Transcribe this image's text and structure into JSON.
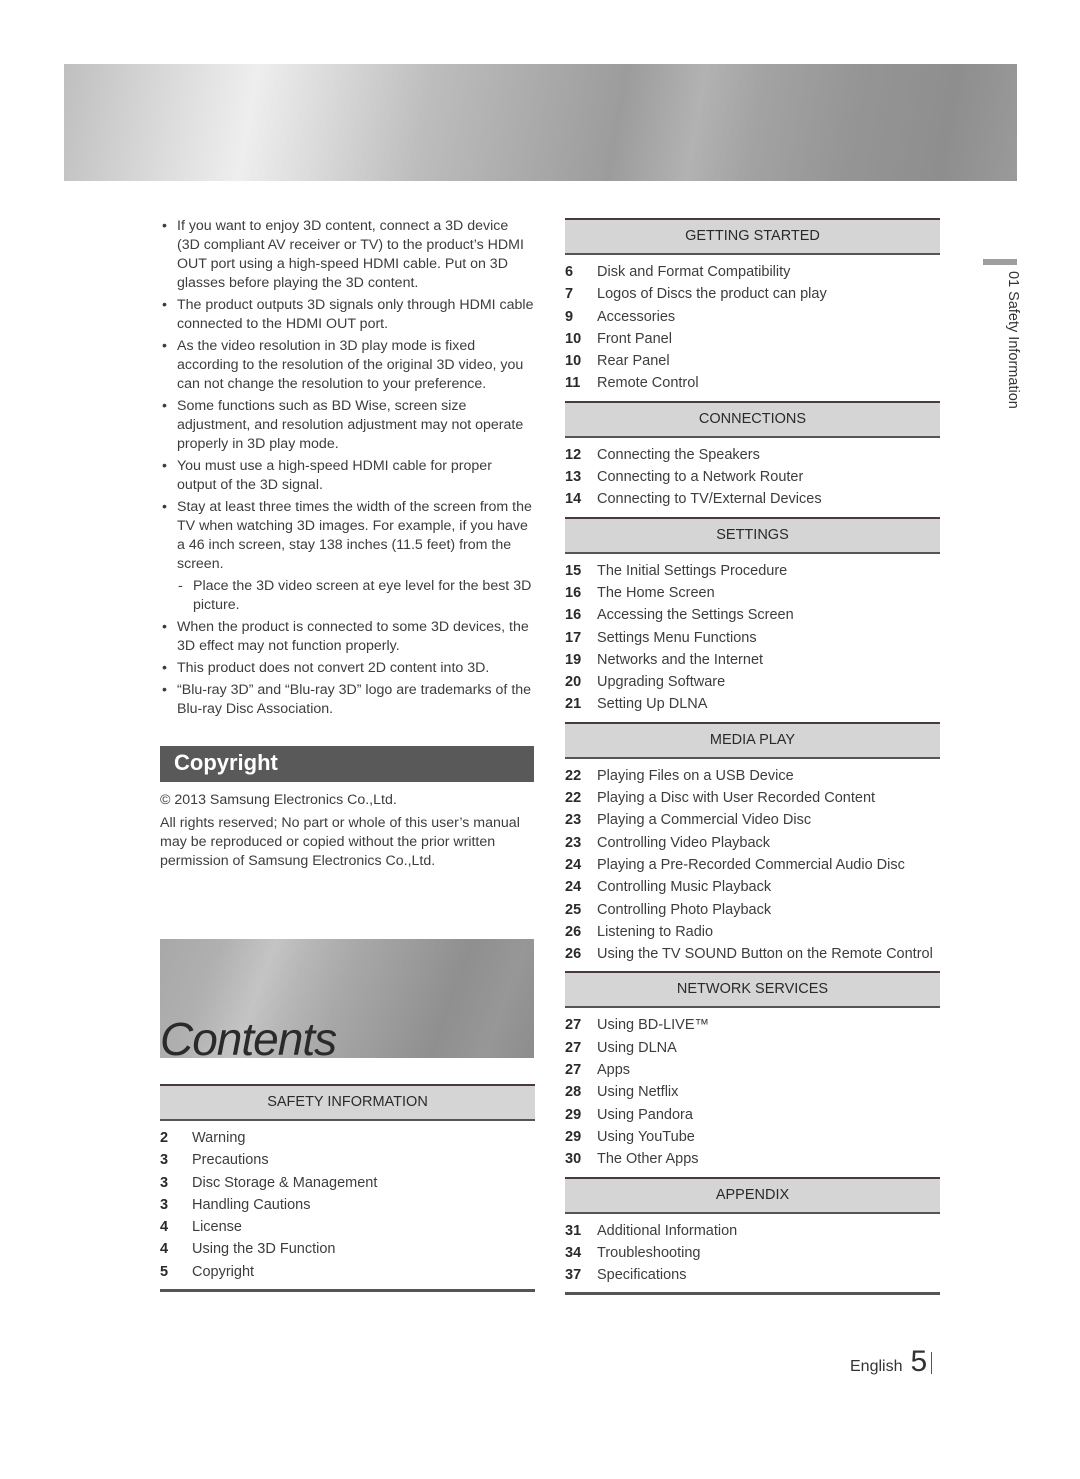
{
  "bullets": [
    {
      "type": "bullet",
      "marker": "•",
      "text": "If you want to enjoy 3D content, connect a 3D device (3D compliant AV receiver or TV) to the product’s HDMI OUT port using a high-speed HDMI cable. Put on 3D glasses before playing the 3D content."
    },
    {
      "type": "bullet",
      "marker": "•",
      "text": "The product outputs 3D signals only through HDMI cable connected to the HDMI OUT port."
    },
    {
      "type": "bullet",
      "marker": "•",
      "text": "As the video resolution in 3D play mode is fixed according to the resolution of the original 3D video, you can not change the resolution to your preference."
    },
    {
      "type": "bullet",
      "marker": "•",
      "text": "Some functions such as BD Wise, screen size adjustment, and resolution adjustment may not operate properly in 3D play mode."
    },
    {
      "type": "bullet",
      "marker": "•",
      "text": "You must use a high-speed HDMI cable for proper output of the 3D signal."
    },
    {
      "type": "bullet",
      "marker": "•",
      "text": "Stay at least three times the width of the screen from the TV when watching 3D images. For example, if you have a 46 inch screen, stay 138 inches (11.5 feet) from the screen."
    },
    {
      "type": "sub",
      "marker": "-",
      "text": "Place the 3D video screen at eye level for the best 3D picture."
    },
    {
      "type": "bullet",
      "marker": "•",
      "text": "When the product is connected to some 3D devices, the 3D effect may not function properly."
    },
    {
      "type": "bullet",
      "marker": "•",
      "text": "This product does not convert 2D content into 3D."
    },
    {
      "type": "bullet",
      "marker": "•",
      "text": "“Blu-ray 3D” and “Blu-ray 3D” logo are trademarks of the Blu-ray Disc Association."
    }
  ],
  "copyright": {
    "heading": "Copyright",
    "line1": "© 2013 Samsung Electronics Co.,Ltd.",
    "line2": "All rights reserved; No part or whole of this user’s manual may be reproduced or copied without the prior written permission of Samsung Electronics Co.,Ltd."
  },
  "contents_title": "Contents",
  "toc_left": [
    {
      "heading": "SAFETY INFORMATION",
      "items": [
        {
          "page": "2",
          "title": "Warning"
        },
        {
          "page": "3",
          "title": "Precautions"
        },
        {
          "page": "3",
          "title": "Disc Storage & Management"
        },
        {
          "page": "3",
          "title": "Handling Cautions"
        },
        {
          "page": "4",
          "title": "License"
        },
        {
          "page": "4",
          "title": "Using the 3D Function"
        },
        {
          "page": "5",
          "title": "Copyright"
        }
      ]
    }
  ],
  "toc_right": [
    {
      "heading": "GETTING STARTED",
      "items": [
        {
          "page": "6",
          "title": "Disk and Format Compatibility"
        },
        {
          "page": "7",
          "title": "Logos of Discs the product can play"
        },
        {
          "page": "9",
          "title": "Accessories"
        },
        {
          "page": "10",
          "title": "Front Panel"
        },
        {
          "page": "10",
          "title": "Rear Panel"
        },
        {
          "page": "11",
          "title": "Remote Control"
        }
      ]
    },
    {
      "heading": "CONNECTIONS",
      "items": [
        {
          "page": "12",
          "title": "Connecting the Speakers"
        },
        {
          "page": "13",
          "title": "Connecting to a Network Router"
        },
        {
          "page": "14",
          "title": "Connecting to TV/External Devices"
        }
      ]
    },
    {
      "heading": "SETTINGS",
      "items": [
        {
          "page": "15",
          "title": "The Initial Settings Procedure"
        },
        {
          "page": "16",
          "title": "The Home Screen"
        },
        {
          "page": "16",
          "title": "Accessing the Settings Screen"
        },
        {
          "page": "17",
          "title": "Settings Menu Functions"
        },
        {
          "page": "19",
          "title": "Networks and the Internet"
        },
        {
          "page": "20",
          "title": "Upgrading Software"
        },
        {
          "page": "21",
          "title": "Setting Up DLNA"
        }
      ]
    },
    {
      "heading": "MEDIA PLAY",
      "items": [
        {
          "page": "22",
          "title": "Playing Files on a USB Device"
        },
        {
          "page": "22",
          "title": "Playing a Disc with User Recorded Content"
        },
        {
          "page": "23",
          "title": "Playing a Commercial Video Disc"
        },
        {
          "page": "23",
          "title": "Controlling Video Playback"
        },
        {
          "page": "24",
          "title": "Playing a Pre-Recorded Commercial Audio Disc"
        },
        {
          "page": "24",
          "title": "Controlling Music Playback"
        },
        {
          "page": "25",
          "title": "Controlling Photo Playback"
        },
        {
          "page": "26",
          "title": "Listening to Radio"
        },
        {
          "page": "26",
          "title": "Using the TV SOUND Button on the Remote Control"
        }
      ]
    },
    {
      "heading": "NETWORK SERVICES",
      "items": [
        {
          "page": "27",
          "title": "Using BD-LIVE™"
        },
        {
          "page": "27",
          "title": "Using DLNA"
        },
        {
          "page": "27",
          "title": "Apps"
        },
        {
          "page": "28",
          "title": "Using Netflix"
        },
        {
          "page": "29",
          "title": "Using Pandora"
        },
        {
          "page": "29",
          "title": "Using YouTube"
        },
        {
          "page": "30",
          "title": "The Other Apps"
        }
      ]
    },
    {
      "heading": "APPENDIX",
      "items": [
        {
          "page": "31",
          "title": "Additional Information"
        },
        {
          "page": "34",
          "title": "Troubleshooting"
        },
        {
          "page": "37",
          "title": "Specifications"
        }
      ]
    }
  ],
  "side_tab": {
    "label": "01   Safety Information"
  },
  "footer": {
    "language": "English",
    "page": "5"
  }
}
